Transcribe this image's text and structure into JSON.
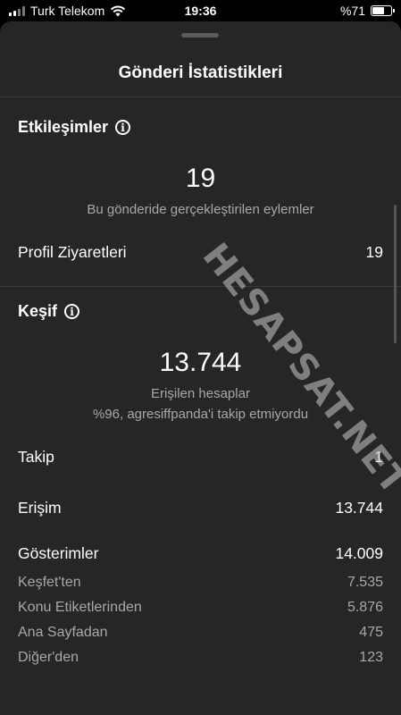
{
  "status_bar": {
    "carrier": "Turk Telekom",
    "time": "19:36",
    "battery": "%71",
    "battery_level": 0.71
  },
  "sheet": {
    "title": "Gönderi İstatistikleri"
  },
  "interactions": {
    "title": "Etkileşimler",
    "total": "19",
    "caption": "Bu gönderide gerçekleştirilen eylemler",
    "profile_visits_label": "Profil Ziyaretleri",
    "profile_visits_value": "19"
  },
  "discovery": {
    "title": "Keşif",
    "accounts_reached": "13.744",
    "accounts_reached_label": "Erişilen hesaplar",
    "not_following_note": "%96, agresiffpanda'i takip etmiyordu",
    "follows_label": "Takip",
    "follows_value": "1",
    "reach_label": "Erişim",
    "reach_value": "13.744",
    "impressions_label": "Gösterimler",
    "impressions_value": "14.009",
    "breakdown": [
      {
        "label": "Keşfet'ten",
        "value": "7.535"
      },
      {
        "label": "Konu Etiketlerinden",
        "value": "5.876"
      },
      {
        "label": "Ana Sayfadan",
        "value": "475"
      },
      {
        "label": "Diğer'den",
        "value": "123"
      }
    ]
  },
  "watermark": "HESAPSAT.NET",
  "icons": {
    "info": "info-circle-icon",
    "wifi": "wifi-icon",
    "signal": "cellular-signal-icon",
    "battery": "battery-icon"
  }
}
